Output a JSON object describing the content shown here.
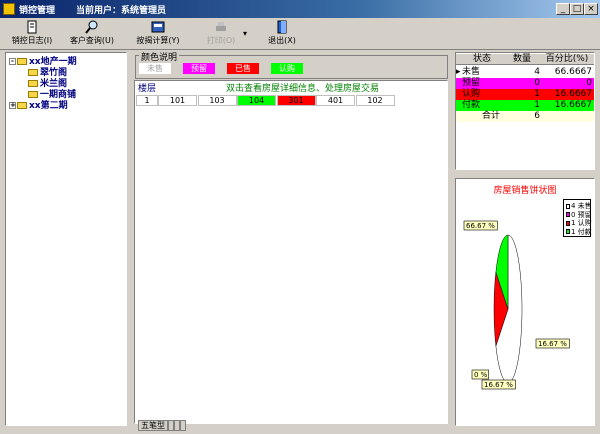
{
  "window": {
    "title": "销控管理",
    "user_label": "当前用户：系统管理员",
    "minimize": "_",
    "maximize": "□",
    "close": "×"
  },
  "toolbar": {
    "log": "销控日志(I)",
    "customer": "客户查询(U)",
    "calc": "按揭计算(Y)",
    "print": "打印(O)",
    "exit": "退出(X)"
  },
  "tree": {
    "root1": "xx地产一期",
    "child1": "翠竹阁",
    "child2": "米兰阁",
    "child3": "一期商铺",
    "root2": "xx第二期",
    "expand_symbol": "-",
    "collapse_symbol": "+"
  },
  "legend": {
    "title": "颜色说明",
    "items": [
      {
        "label": "未售",
        "color": "#ffffff"
      },
      {
        "label": "预留",
        "color": "#ff00ff"
      },
      {
        "label": "已售",
        "color": "#ff0000"
      },
      {
        "label": "认购",
        "color": "#00ff00"
      }
    ]
  },
  "grid": {
    "floor_header": "楼层",
    "hint": "双击查看房屋详细信息、处理房屋交易",
    "rows": [
      {
        "floor": "1",
        "units": [
          {
            "no": "101",
            "color": "#ffffff"
          },
          {
            "no": "103",
            "color": "#ffffff"
          },
          {
            "no": "104",
            "color": "#00ff00"
          },
          {
            "no": "301",
            "color": "#ff0000"
          },
          {
            "no": "401",
            "color": "#ffffff"
          },
          {
            "no": "102",
            "color": "#ffffff"
          }
        ]
      }
    ],
    "tabs": [
      "五笔型",
      "",
      "",
      ""
    ]
  },
  "stats": {
    "headers": [
      "状态",
      "数量",
      "百分比(%)"
    ],
    "rows": [
      {
        "status": "未售",
        "count": "4",
        "pct": "66.6667",
        "color": "#ffffff"
      },
      {
        "status": "预留",
        "count": "0",
        "pct": "0",
        "color": "#ff00ff"
      },
      {
        "status": "认购",
        "count": "1",
        "pct": "16.6667",
        "color": "#ff0000"
      },
      {
        "status": "付款",
        "count": "1",
        "pct": "16.6667",
        "color": "#00ff00"
      },
      {
        "status": "合计",
        "count": "6",
        "pct": "",
        "color": "#ffffe0"
      }
    ]
  },
  "chart_data": {
    "type": "pie",
    "title": "房屋销售饼状图",
    "categories": [
      "未售",
      "预留",
      "认购",
      "付款"
    ],
    "values": [
      4,
      0,
      1,
      1
    ],
    "percent_labels": [
      "66.67 %",
      "0 %",
      "16.67 %",
      "16.67 %"
    ],
    "colors": [
      "#ffffff",
      "#ff00ff",
      "#ff0000",
      "#00ff00"
    ],
    "legend": [
      "4 未售",
      "0 预留",
      "1 认购",
      "1 付款"
    ]
  }
}
